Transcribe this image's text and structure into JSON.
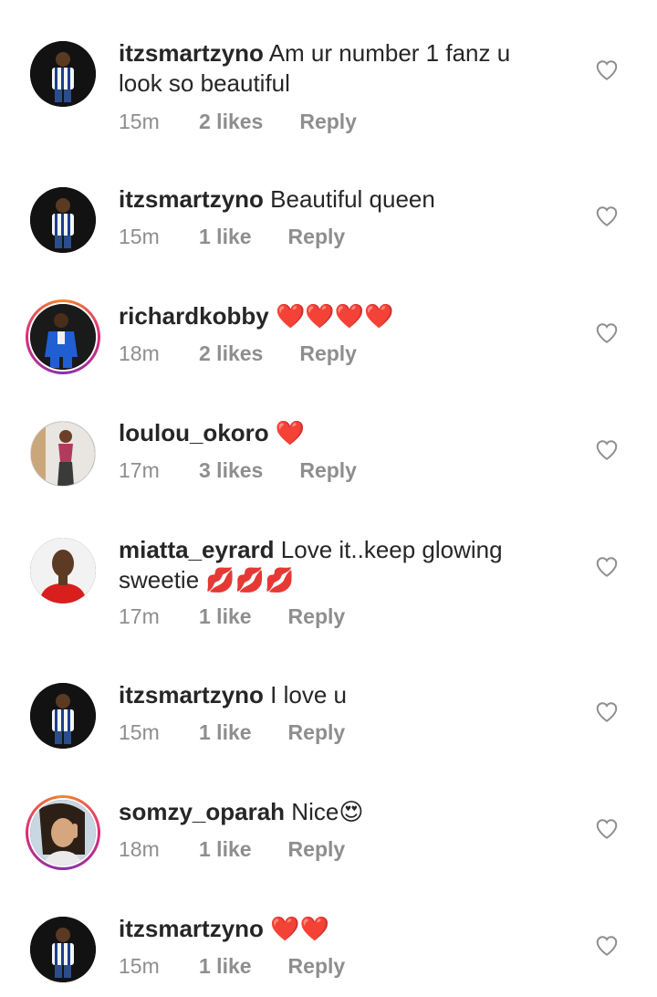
{
  "reply_label": "Reply",
  "comments": [
    {
      "user": "itzsmartzyno",
      "text": "Am ur number 1 fanz u look so beautiful",
      "time": "15m",
      "likes": "2 likes",
      "avatar": "jersey",
      "story": false
    },
    {
      "user": "itzsmartzyno",
      "text": "Beautiful queen",
      "time": "15m",
      "likes": "1 like",
      "avatar": "jersey",
      "story": false
    },
    {
      "user": "richardkobby",
      "text": "❤️❤️❤️❤️",
      "time": "18m",
      "likes": "2 likes",
      "avatar": "suit",
      "story": true
    },
    {
      "user": "loulou_okoro",
      "text": "❤️",
      "time": "17m",
      "likes": "3 likes",
      "avatar": "dress",
      "story": false
    },
    {
      "user": "miatta_eyrard",
      "text": "Love it..keep glowing sweetie 💋💋💋",
      "time": "17m",
      "likes": "1 like",
      "avatar": "red",
      "story": false
    },
    {
      "user": "itzsmartzyno",
      "text": "I love u",
      "time": "15m",
      "likes": "1 like",
      "avatar": "jersey",
      "story": false
    },
    {
      "user": "somzy_oparah",
      "text": "Nice😍",
      "time": "18m",
      "likes": "1 like",
      "avatar": "selfie",
      "story": true
    },
    {
      "user": "itzsmartzyno",
      "text": "❤️❤️",
      "time": "15m",
      "likes": "1 like",
      "avatar": "jersey",
      "story": false
    }
  ]
}
